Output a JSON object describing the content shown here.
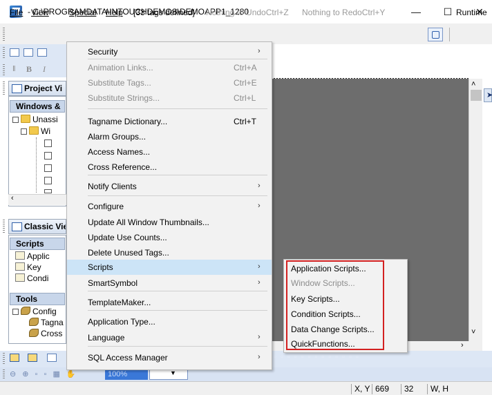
{
  "window": {
    "title": "- C:\\PROGRAMDATA\\INTOUCHDEMOS\\DEMOAPP1_1280",
    "minimize_glyph": "—",
    "maximize_glyph": "☐",
    "close_glyph": "✕"
  },
  "menubar": {
    "file": "File",
    "view": "View",
    "special": "Special",
    "help": "Help",
    "tags_defined": "[33 tags defined]",
    "undo": "Nothing to UndoCtrl+Z",
    "redo": "Nothing to RedoCtrl+Y",
    "runtime": "Runtime"
  },
  "toolbar_text": {
    "bold": "B",
    "italic": "I"
  },
  "project_view": {
    "title": "Project Vi",
    "tab": "Windows &",
    "items": [
      "Unassi",
      "Wi"
    ]
  },
  "classic_view": {
    "title": "Classic Vie",
    "scripts_tab": "Scripts",
    "scripts_items": [
      "Applic",
      "Key",
      "Condi"
    ],
    "tools_tab": "Tools",
    "tools_items": [
      "Config",
      "Tagna",
      "Cross"
    ]
  },
  "zoom": "100%",
  "status": {
    "xy_label": "X, Y",
    "x_value": "669",
    "y_value": "32",
    "wh_label": "W, H"
  },
  "special_menu": {
    "items": [
      {
        "label": "Security",
        "shortcut": "",
        "submenu": true,
        "disabled": false
      },
      {
        "label": "Animation Links...",
        "shortcut": "Ctrl+A",
        "submenu": false,
        "disabled": true
      },
      {
        "label": "Substitute Tags...",
        "shortcut": "Ctrl+E",
        "submenu": false,
        "disabled": true
      },
      {
        "label": "Substitute Strings...",
        "shortcut": "Ctrl+L",
        "submenu": false,
        "disabled": true
      },
      {
        "label": "Tagname Dictionary...",
        "shortcut": "Ctrl+T",
        "submenu": false,
        "disabled": false
      },
      {
        "label": "Alarm Groups...",
        "shortcut": "",
        "submenu": false,
        "disabled": false
      },
      {
        "label": "Access Names...",
        "shortcut": "",
        "submenu": false,
        "disabled": false
      },
      {
        "label": "Cross Reference...",
        "shortcut": "",
        "submenu": false,
        "disabled": false
      },
      {
        "label": "Notify Clients",
        "shortcut": "",
        "submenu": true,
        "disabled": false
      },
      {
        "label": "Configure",
        "shortcut": "",
        "submenu": true,
        "disabled": false
      },
      {
        "label": "Update All Window Thumbnails...",
        "shortcut": "",
        "submenu": false,
        "disabled": false
      },
      {
        "label": "Update Use Counts...",
        "shortcut": "",
        "submenu": false,
        "disabled": false
      },
      {
        "label": "Delete Unused Tags...",
        "shortcut": "",
        "submenu": false,
        "disabled": false
      },
      {
        "label": "Scripts",
        "shortcut": "",
        "submenu": true,
        "disabled": false,
        "highlighted": true
      },
      {
        "label": "SmartSymbol",
        "shortcut": "",
        "submenu": true,
        "disabled": false
      },
      {
        "label": "TemplateMaker...",
        "shortcut": "",
        "submenu": false,
        "disabled": false
      },
      {
        "label": "Application Type...",
        "shortcut": "",
        "submenu": false,
        "disabled": false
      },
      {
        "label": "Language",
        "shortcut": "",
        "submenu": true,
        "disabled": false
      },
      {
        "label": "SQL Access Manager",
        "shortcut": "",
        "submenu": true,
        "disabled": false
      }
    ]
  },
  "scripts_submenu": {
    "items": [
      {
        "label": "Application Scripts...",
        "disabled": false
      },
      {
        "label": "Window Scripts...",
        "disabled": true
      },
      {
        "label": "Key Scripts...",
        "disabled": false
      },
      {
        "label": "Condition Scripts...",
        "disabled": false
      },
      {
        "label": "Data Change Scripts...",
        "disabled": false
      },
      {
        "label": "QuickFunctions...",
        "disabled": false
      }
    ]
  },
  "colors": {
    "highlight": "#cce4f7",
    "annotation_box": "#d32020",
    "canvas": "#6d6d6d"
  }
}
